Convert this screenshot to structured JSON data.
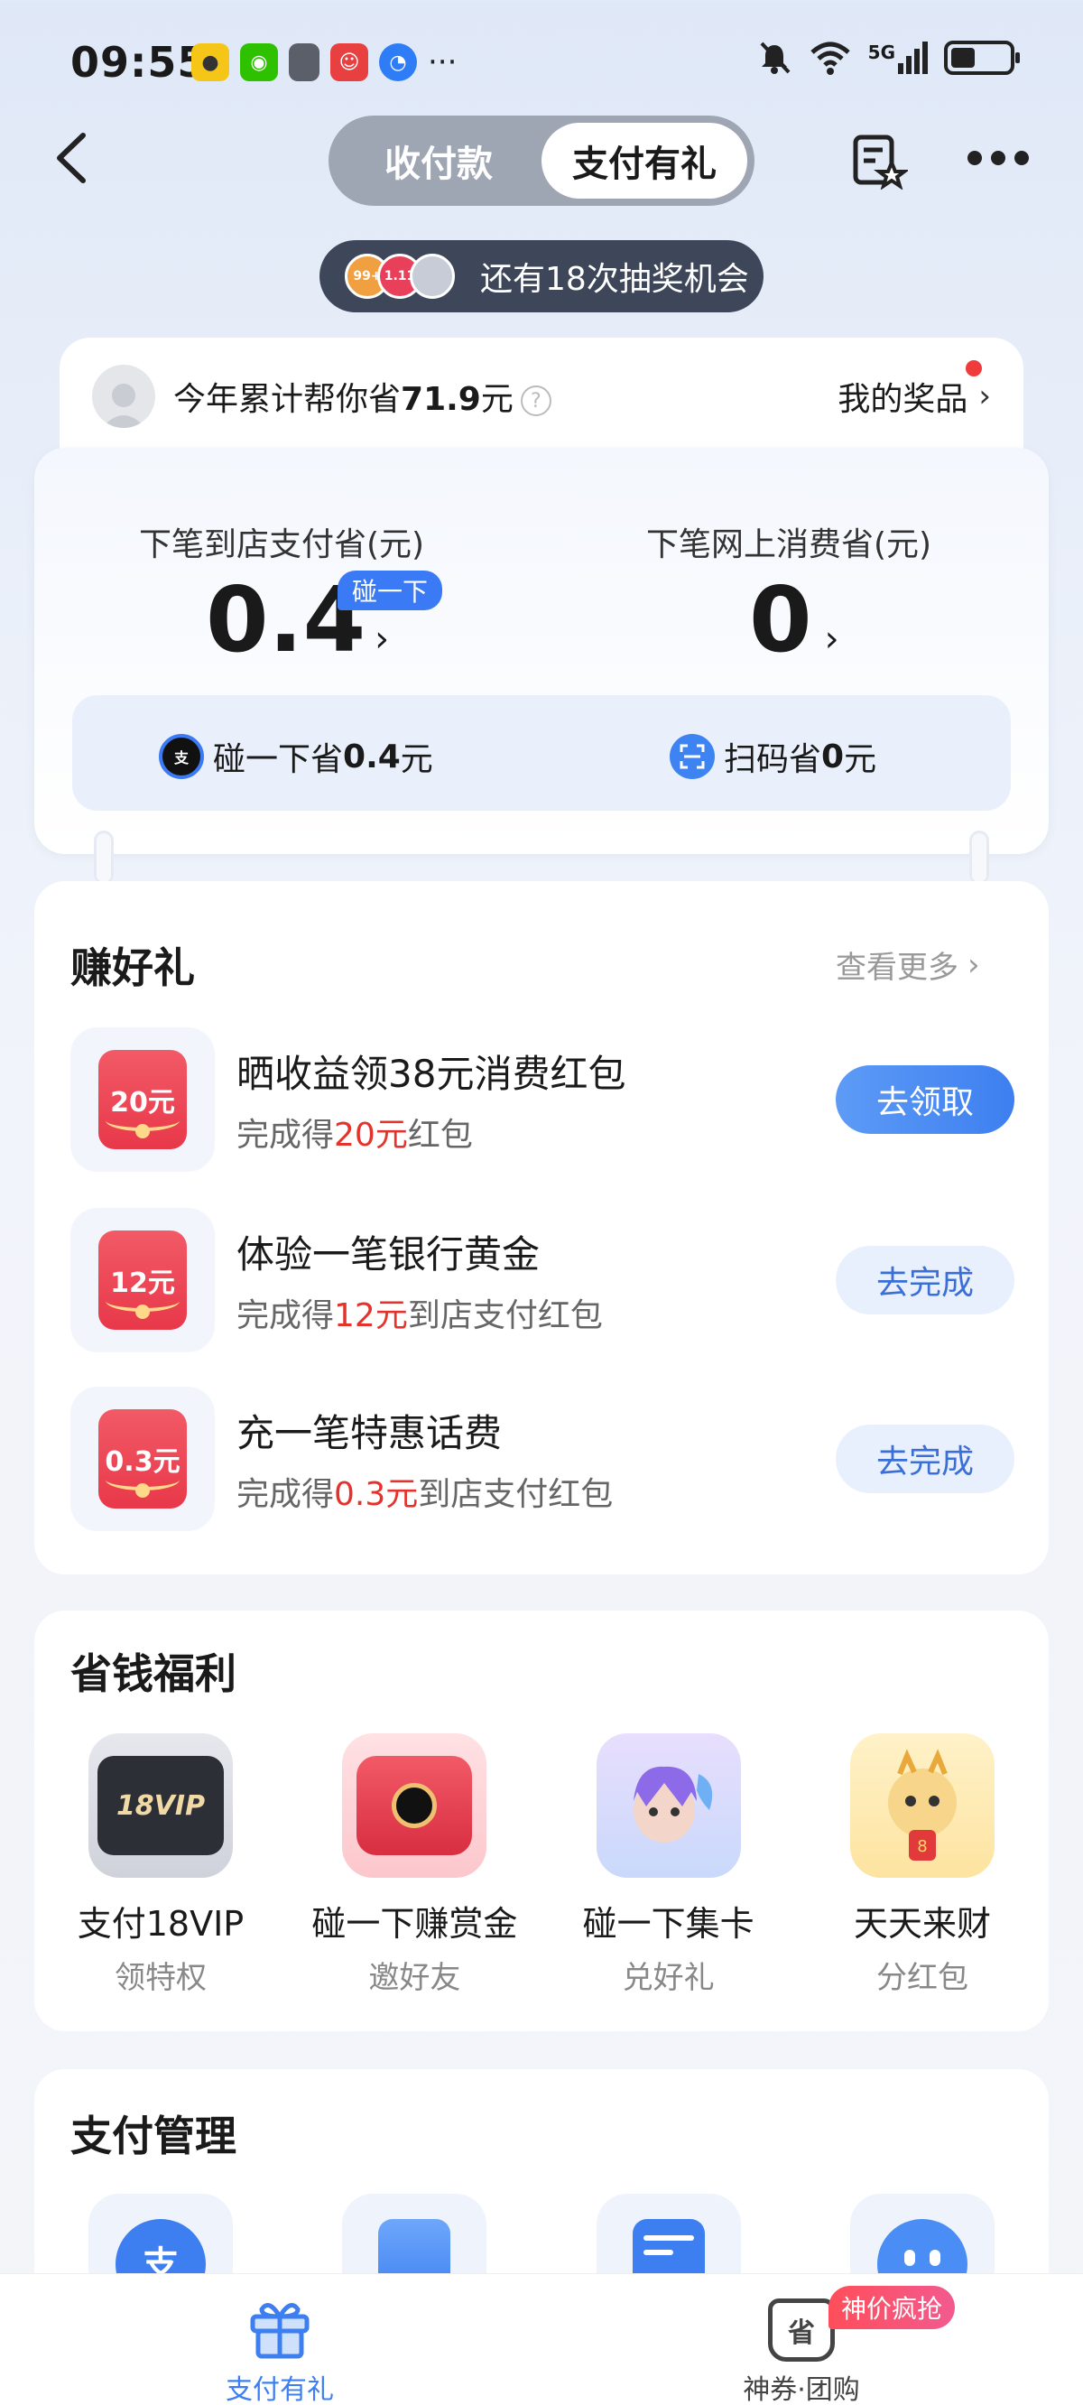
{
  "status_bar": {
    "time": "09:55",
    "network": "5G"
  },
  "nav": {
    "tabs": [
      {
        "label": "收付款",
        "active": false
      },
      {
        "label": "支付有礼",
        "active": true
      }
    ]
  },
  "lottery": {
    "text": "还有18次抽奖机会",
    "coin_labels": [
      "99+",
      "1.11"
    ]
  },
  "savings": {
    "summary_prefix": "今年累计帮你省",
    "summary_amount": "71.9",
    "summary_suffix": "元",
    "my_prizes": "我的奖品",
    "store": {
      "label": "下笔到店支付省(元)",
      "value": "0.4",
      "tag": "碰一下"
    },
    "online": {
      "label": "下笔网上消费省(元)",
      "value": "0"
    },
    "tap_pay": {
      "prefix": "碰一下省",
      "amount": "0.4",
      "suffix": "元"
    },
    "scan_pay": {
      "prefix": "扫码省",
      "amount": "0",
      "suffix": "元"
    }
  },
  "earn": {
    "title": "赚好礼",
    "more": "查看更多",
    "tasks": [
      {
        "icon_label": "20元",
        "title": "晒收益领38元消费红包",
        "sub_prefix": "完成得",
        "sub_amount": "20元",
        "sub_suffix": "红包",
        "button": "去领取",
        "primary": true
      },
      {
        "icon_label": "12元",
        "title": "体验一笔银行黄金",
        "sub_prefix": "完成得",
        "sub_amount": "12元",
        "sub_suffix": "到店支付红包",
        "button": "去完成",
        "primary": false
      },
      {
        "icon_label": "0.3元",
        "title": "充一笔特惠话费",
        "sub_prefix": "完成得",
        "sub_amount": "0.3元",
        "sub_suffix": "到店支付红包",
        "button": "去完成",
        "primary": false
      }
    ]
  },
  "benefits": {
    "title": "省钱福利",
    "items": [
      {
        "title": "支付18VIP",
        "sub": "领特权",
        "image_label": "18VIP"
      },
      {
        "title": "碰一下赚赏金",
        "sub": "邀好友"
      },
      {
        "title": "碰一下集卡",
        "sub": "兑好礼"
      },
      {
        "title": "天天来财",
        "sub": "分红包"
      }
    ]
  },
  "management": {
    "title": "支付管理"
  },
  "tabbar": {
    "tabs": [
      {
        "label": "支付有礼",
        "active": true
      },
      {
        "label": "神券·团购",
        "active": false
      }
    ],
    "hot_badge": "神价疯抢",
    "coupon_icon_char": "省"
  },
  "colors": {
    "accent_blue": "#3a7af5",
    "red_amount": "#e4332c",
    "envelope_red": "#e8384a"
  }
}
